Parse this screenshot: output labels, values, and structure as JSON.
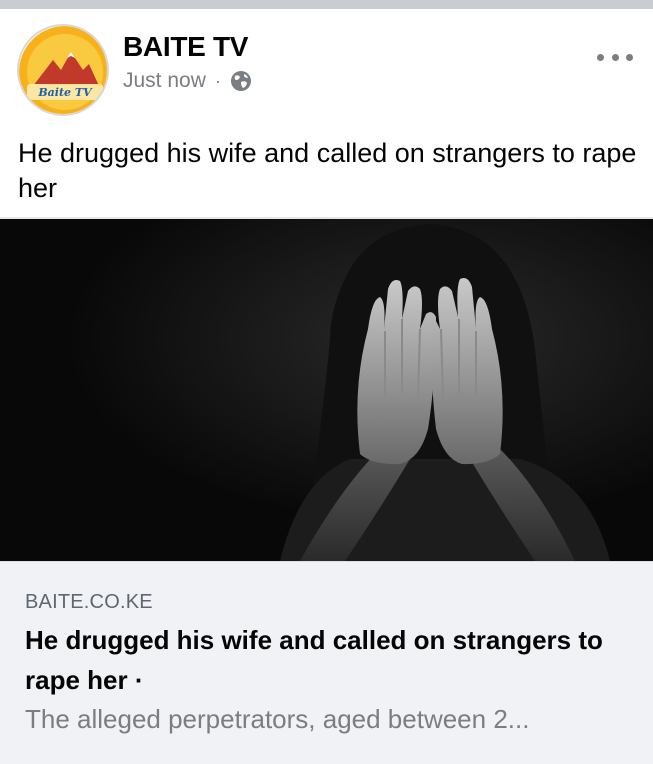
{
  "post": {
    "page_name": "BAITE TV",
    "timestamp": "Just now",
    "separator": "·",
    "privacy_icon": "globe-icon",
    "more_icon": "more-options-icon",
    "caption": "He drugged his wife and called on strangers to rape her"
  },
  "avatar": {
    "logo_text": "Baite TV",
    "colors": {
      "sun": "#f7b21b",
      "mountain": "#c0392b",
      "text": "#1e5fa8"
    }
  },
  "link_preview": {
    "domain": "BAITE.CO.KE",
    "title": "He drugged his wife and called on strangers to rape her",
    "title_suffix": "·",
    "description": "The alleged perpetrators, aged between 2..."
  }
}
